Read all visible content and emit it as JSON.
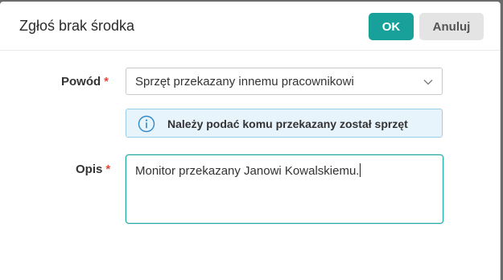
{
  "dialog": {
    "title": "Zgłoś brak środka",
    "ok_label": "OK",
    "cancel_label": "Anuluj"
  },
  "form": {
    "reason": {
      "label": "Powód",
      "required_mark": "*",
      "selected_value": "Sprzęt przekazany innemu pracownikowi"
    },
    "info_message": "Należy podać komu przekazany został sprzęt",
    "description": {
      "label": "Opis",
      "required_mark": "*",
      "value": "Monitor przekazany Janowi Kowalskiemu."
    }
  },
  "colors": {
    "accent": "#18a19a",
    "required": "#e0473d",
    "info_bg": "#e8f4fb",
    "info_border": "#9ccde8"
  }
}
